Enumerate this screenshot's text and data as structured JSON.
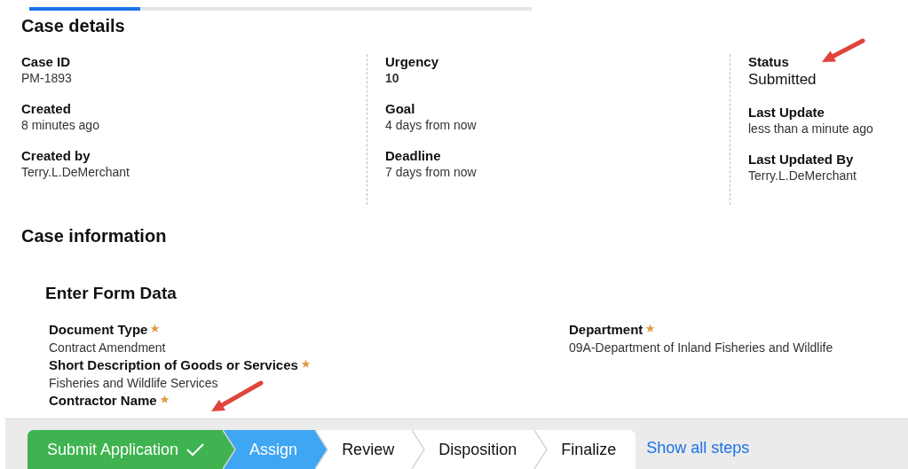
{
  "progress": {
    "level": 0.22
  },
  "case_details": {
    "title": "Case details",
    "columns": [
      [
        {
          "label": "Case ID",
          "value": "PM-1893",
          "kind": "plain"
        },
        {
          "label": "Created",
          "value": "8 minutes ago",
          "kind": "plain"
        },
        {
          "label": "Created by",
          "value": "Terry.L.DeMerchant",
          "kind": "plain"
        }
      ],
      [
        {
          "label": "Urgency",
          "value": "10",
          "kind": "bold"
        },
        {
          "label": "Goal",
          "value": "4 days from now",
          "kind": "plain"
        },
        {
          "label": "Deadline",
          "value": "7 days from now",
          "kind": "plain"
        }
      ],
      [
        {
          "label": "Status",
          "value": "Submitted",
          "kind": "large"
        },
        {
          "label": "Last Update",
          "value": "less than a minute ago",
          "kind": "plain"
        },
        {
          "label": "Last Updated By",
          "value": "Terry.L.DeMerchant",
          "kind": "plain"
        }
      ]
    ]
  },
  "case_information": {
    "title": "Case information"
  },
  "form": {
    "title": "Enter Form Data",
    "columns": [
      [
        {
          "label": "Document Type",
          "required": true,
          "value": "Contract Amendment"
        },
        {
          "label": "Short Description of Goods or Services",
          "required": true,
          "value": "Fisheries and Wildlife Services"
        },
        {
          "label": "Contractor Name",
          "required": true
        }
      ],
      [
        {
          "label": "Department",
          "required": true,
          "value": "09A-Department of Inland Fisheries and Wildlife"
        }
      ]
    ]
  },
  "steps": [
    {
      "label": "Submit Application",
      "done": true,
      "selected": false
    },
    {
      "label": "Assign",
      "done": false,
      "selected": true
    },
    {
      "label": "Review",
      "done": false,
      "selected": false
    },
    {
      "label": "Disposition",
      "done": false,
      "selected": false
    },
    {
      "label": "Finalize",
      "done": false,
      "selected": false
    }
  ],
  "show_all_steps": "Show all steps"
}
